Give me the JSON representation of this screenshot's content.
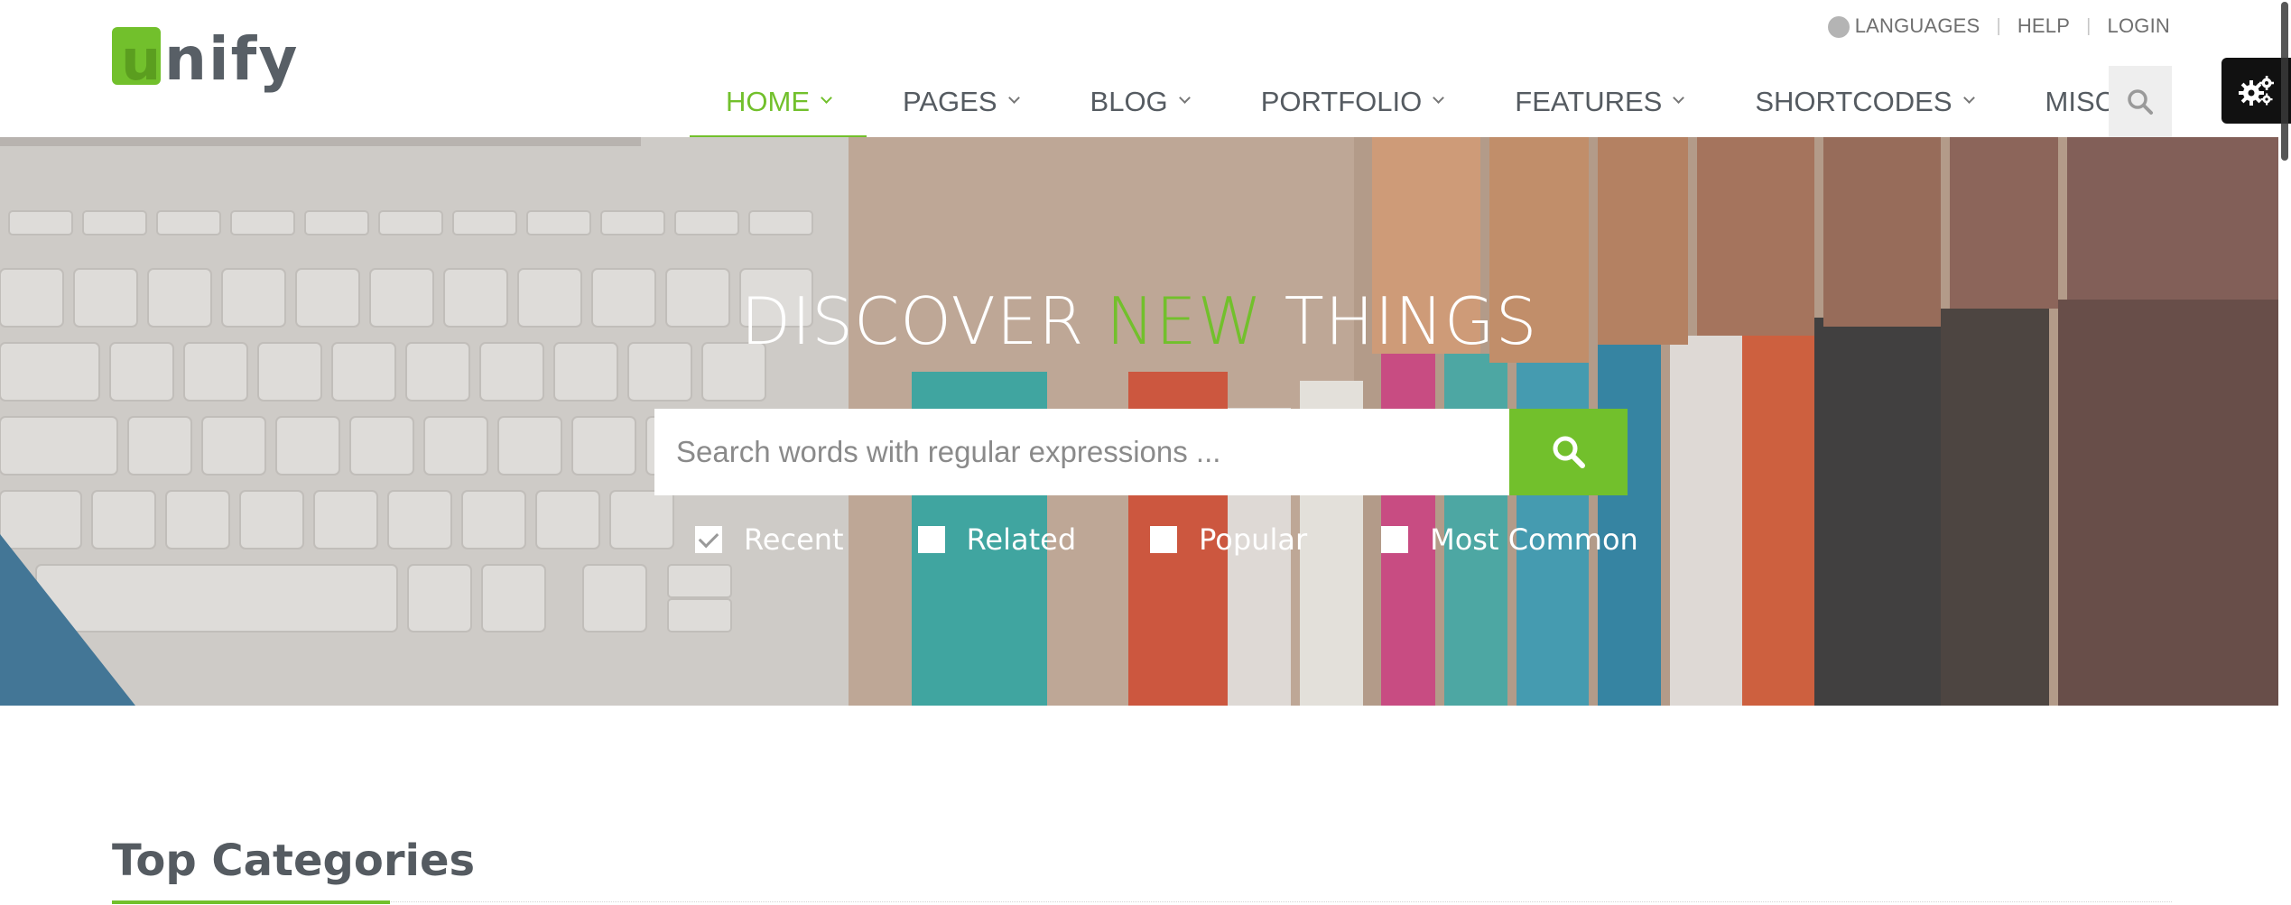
{
  "brand": {
    "logo_letter": "u",
    "logo_rest": "nify",
    "accent_color": "#72c02c"
  },
  "topbar": {
    "languages": "LANGUAGES",
    "help": "HELP",
    "login": "LOGIN",
    "separator": "|",
    "icons": [
      "globe-icon"
    ]
  },
  "nav": {
    "items": [
      {
        "label": "HOME",
        "active": true
      },
      {
        "label": "PAGES",
        "active": false
      },
      {
        "label": "BLOG",
        "active": false
      },
      {
        "label": "PORTFOLIO",
        "active": false
      },
      {
        "label": "FEATURES",
        "active": false
      },
      {
        "label": "SHORTCODES",
        "active": false
      },
      {
        "label": "MISC",
        "active": false
      }
    ],
    "search_icon": "search-icon"
  },
  "style_switcher": {
    "icon": "gears-icon"
  },
  "hero": {
    "title_part1": "DISCOVER ",
    "title_accent": "NEW",
    "title_part2": " THINGS",
    "search": {
      "placeholder": "Search words with regular expressions ...",
      "value": ""
    },
    "filters": [
      {
        "label": "Recent",
        "checked": true
      },
      {
        "label": "Related",
        "checked": false
      },
      {
        "label": "Popular",
        "checked": false
      },
      {
        "label": "Most Common",
        "checked": false
      }
    ]
  },
  "content": {
    "section_title": "Top Categories"
  }
}
